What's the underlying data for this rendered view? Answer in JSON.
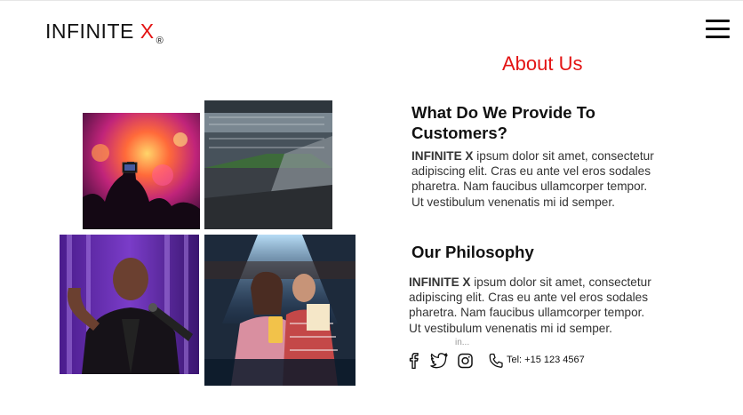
{
  "header": {
    "logo_main": "INFINITE ",
    "logo_accent": "X",
    "logo_mark": "®",
    "menu_icon": "hamburger-menu-icon"
  },
  "about": {
    "title": "About Us"
  },
  "gallery": {
    "images": [
      {
        "name": "concert-crowd-photo"
      },
      {
        "name": "stadium-crowd-photo"
      },
      {
        "name": "comedian-on-stage-photo"
      },
      {
        "name": "couple-at-cinema-photo"
      }
    ]
  },
  "provide": {
    "heading": "What Do We Provide To Customers?",
    "brand": "INFINITE X",
    "text": "  ipsum dolor sit amet, consectetur\nadipiscing elit. Cras eu ante vel eros sodales\npharetra. Nam faucibus ullamcorper tempor.\nUt vestibulum venenatis mi id semper."
  },
  "philosophy": {
    "heading": "Our Philosophy",
    "brand": "INFINITE X",
    "text": "  ipsum dolor sit amet, consectetur\nadipiscing elit. Cras eu ante vel eros sodales\npharetra. Nam faucibus ullamcorper tempor.\nUt vestibulum venenatis mi id semper."
  },
  "footer": {
    "social_hint": "in...",
    "icons": [
      "facebook-icon",
      "twitter-icon",
      "instagram-icon",
      "phone-icon"
    ],
    "tel": "Tel: +15 123 4567"
  },
  "colors": {
    "accent": "#e31414",
    "text": "#111111",
    "body_text": "#333333"
  }
}
